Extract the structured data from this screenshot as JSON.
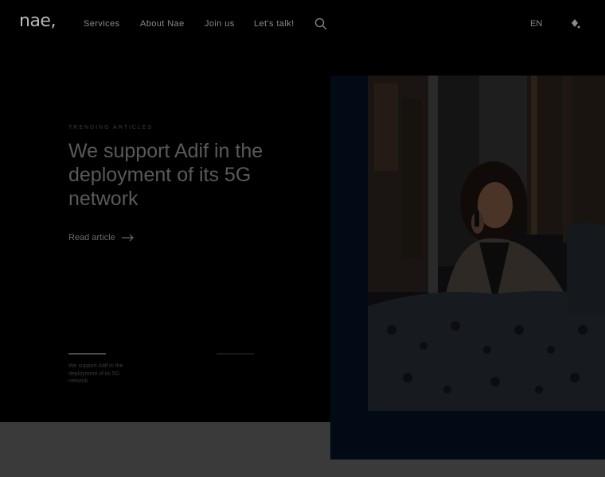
{
  "header": {
    "logo": "nae,",
    "nav": [
      {
        "label": "Services"
      },
      {
        "label": "About Nae"
      },
      {
        "label": "Join us"
      },
      {
        "label": "Let's talk!"
      }
    ],
    "lang": "EN"
  },
  "hero": {
    "kicker": "TRENDING ARTICLES",
    "headline": "We support Adif in the deployment of its 5G network",
    "cta": "Read article"
  },
  "slider": [
    {
      "text": "We support Adif in the deployment of its 5G network",
      "active": true
    },
    {
      "text": "",
      "active": false
    }
  ],
  "colors": {
    "background": "#000000",
    "bottom_strip": "#3a3a3a",
    "photo_frame": "#020a16",
    "text_dim": "#595959"
  }
}
